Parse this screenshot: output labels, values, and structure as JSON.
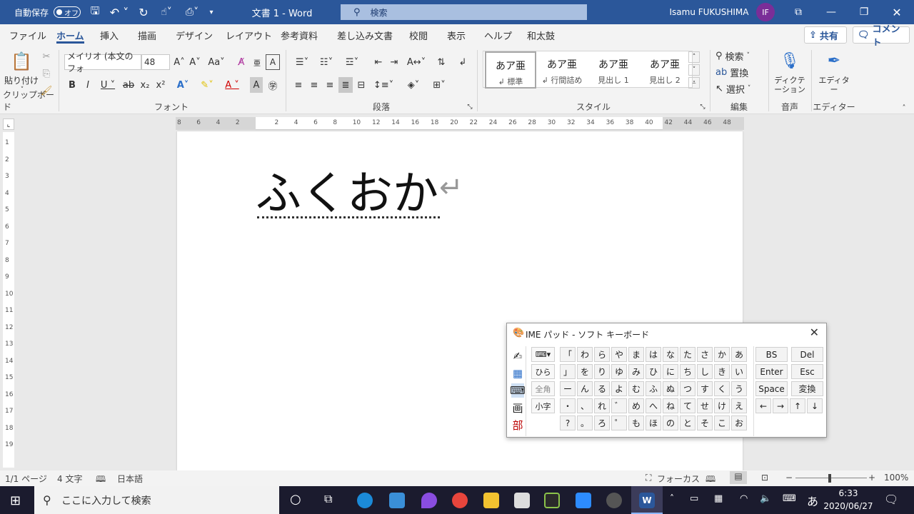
{
  "titlebar": {
    "autosave_label": "自動保存",
    "autosave_state": "オフ",
    "doc_title": "文書 1  -  Word",
    "search_placeholder": "検索",
    "user_name": "Isamu FUKUSHIMA",
    "user_initials": "IF"
  },
  "menu": {
    "tabs": [
      "ファイル",
      "ホーム",
      "挿入",
      "描画",
      "デザイン",
      "レイアウト",
      "参考資料",
      "差し込み文書",
      "校閲",
      "表示",
      "ヘルプ",
      "和太鼓"
    ],
    "share_label": "共有",
    "comment_label": "コメント"
  },
  "ribbon": {
    "clipboard": {
      "paste_label": "貼り付け",
      "group_label": "クリップボード"
    },
    "font": {
      "font_name": "メイリオ (本文のフォ",
      "font_size": "48",
      "group_label": "フォント"
    },
    "paragraph": {
      "group_label": "段落"
    },
    "styles": {
      "group_label": "スタイル",
      "items": [
        {
          "preview": "あア亜",
          "name": "↲ 標準"
        },
        {
          "preview": "あア亜",
          "name": "↲ 行間詰め"
        },
        {
          "preview": "あア亜",
          "name": "見出し 1"
        },
        {
          "preview": "あア亜",
          "name": "見出し 2"
        }
      ]
    },
    "editing": {
      "find": "検索",
      "replace": "置換",
      "select": "選択",
      "group_label": "編集"
    },
    "voice": {
      "dictate": "ディクテーション",
      "group_label": "音声"
    },
    "editor": {
      "label": "エディター",
      "group_label": "エディター"
    }
  },
  "ruler_numbers": [
    "8",
    "6",
    "4",
    "2",
    "",
    "2",
    "4",
    "6",
    "8",
    "10",
    "12",
    "14",
    "16",
    "18",
    "20",
    "22",
    "24",
    "26",
    "28",
    "30",
    "32",
    "34",
    "36",
    "38",
    "40",
    "42",
    "44",
    "46",
    "48"
  ],
  "vruler_numbers": [
    "1",
    "2",
    "3",
    "4",
    "5",
    "6",
    "7",
    "8",
    "9",
    "10",
    "11",
    "12",
    "13",
    "14",
    "15",
    "16",
    "17",
    "18",
    "19"
  ],
  "document": {
    "text": "ふくおか"
  },
  "ime_pad": {
    "title": "IME パッド - ソフト キーボード",
    "mode_keys": [
      "ひら",
      "全角",
      "小字"
    ],
    "side_icons": [
      "✍",
      "▦",
      "⌨",
      "画",
      "部"
    ],
    "kana_rows": [
      [
        "「",
        "わ",
        "ら",
        "や",
        "ま",
        "は",
        "な",
        "た",
        "さ",
        "か",
        "あ"
      ],
      [
        "」",
        "を",
        "り",
        "ゆ",
        "み",
        "ひ",
        "に",
        "ち",
        "し",
        "き",
        "い"
      ],
      [
        "ー",
        "ん",
        "る",
        "よ",
        "む",
        "ふ",
        "ぬ",
        "つ",
        "す",
        "く",
        "う"
      ],
      [
        "・",
        "、",
        "れ",
        "゛",
        "め",
        "へ",
        "ね",
        "て",
        "せ",
        "け",
        "え"
      ],
      [
        "?",
        "。",
        "ろ",
        "゜",
        "も",
        "ほ",
        "の",
        "と",
        "そ",
        "こ",
        "お"
      ]
    ],
    "func_keys": [
      [
        "BS",
        "Del"
      ],
      [
        "Enter",
        "Esc"
      ],
      [
        "Space",
        "変換"
      ]
    ],
    "arrow_keys": [
      "←",
      "→",
      "↑",
      "↓"
    ]
  },
  "statusbar": {
    "page": "1/1 ページ",
    "words": "4 文字",
    "language": "日本語",
    "focus": "フォーカス",
    "zoom": "100%"
  },
  "taskbar": {
    "search_placeholder": "ここに入力して検索",
    "time": "6:33",
    "date": "2020/06/27",
    "ime_mode": "あ"
  },
  "colors": {
    "brand": "#2b579a",
    "avatar": "#7a2e98",
    "taskbar": "#1b1b2e"
  }
}
